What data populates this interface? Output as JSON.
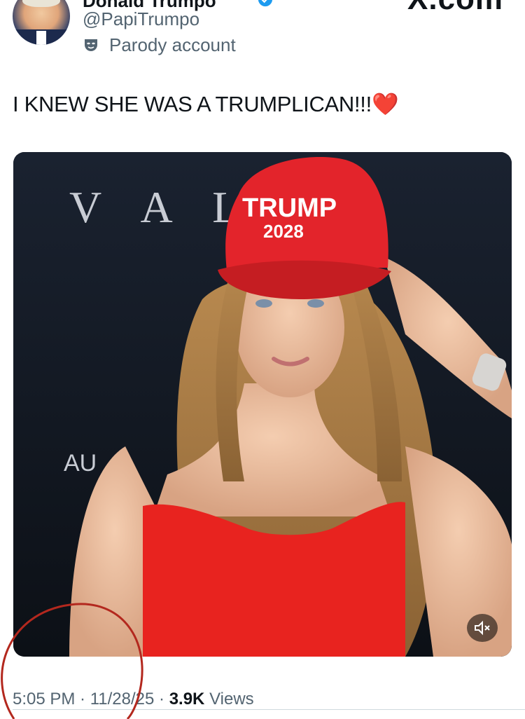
{
  "header": {
    "display_name": "Donald Trumpo",
    "handle": "@PapiTrumpo",
    "parody_label": "Parody account",
    "watermark": "X.com"
  },
  "tweet": {
    "text": "I KNEW SHE WAS A TRUMPLICAN!!!",
    "emoji": "❤️"
  },
  "media": {
    "backdrop_text": "V A L R",
    "backdrop_text_2": "AU",
    "hat_text_line1": "TRUMP",
    "hat_text_line2": "2028",
    "mute_icon": "speaker-muted-icon"
  },
  "meta": {
    "time": "5:05 PM",
    "separator": " · ",
    "date": "11/28/25",
    "views_count": "3.9K",
    "views_label": "Views"
  },
  "colors": {
    "hat_red": "#e3242b",
    "dress_red": "#e8231f",
    "backdrop": "#10141c",
    "annotation": "#b3281e"
  }
}
